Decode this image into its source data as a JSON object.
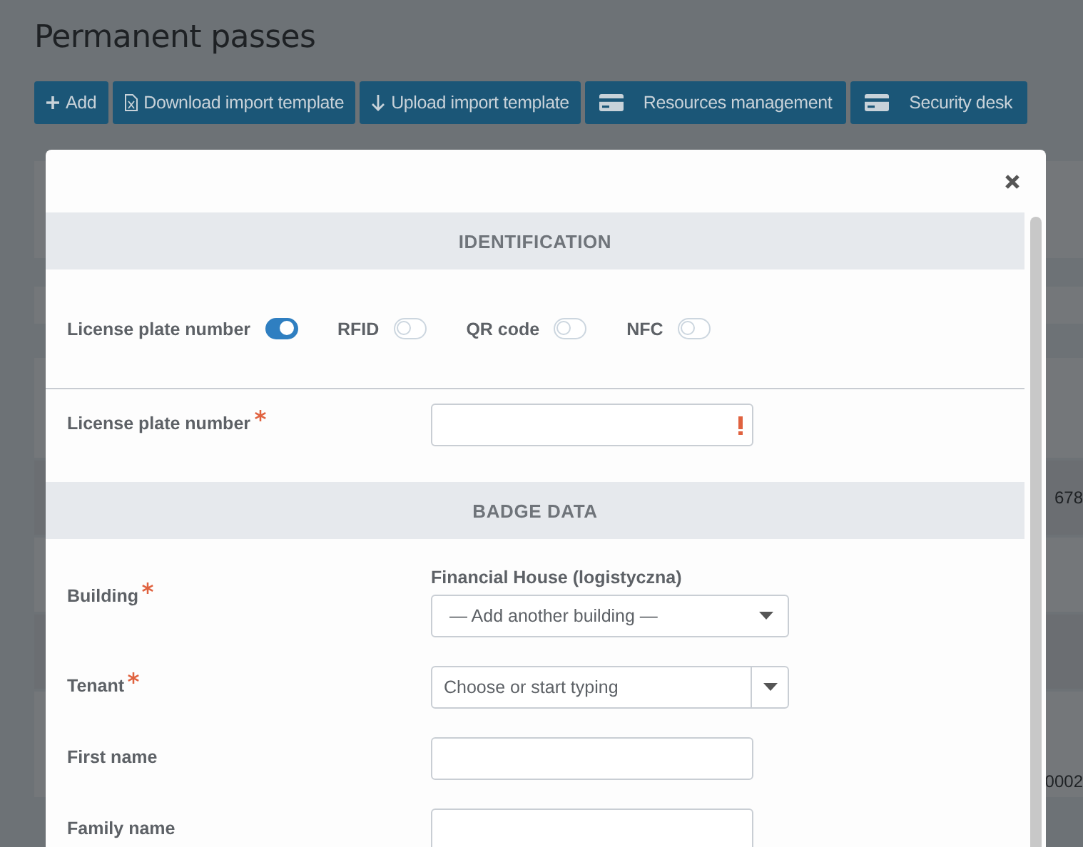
{
  "page": {
    "title": "Permanent passes"
  },
  "toolbar": [
    {
      "label": "Add",
      "kind": "add"
    },
    {
      "label": "Download import template",
      "kind": "download"
    },
    {
      "label": "Upload import template",
      "kind": "upload"
    },
    {
      "label": "Resources management",
      "kind": "resources"
    },
    {
      "label": "Security desk",
      "kind": "desk"
    }
  ],
  "background_rows": [
    {
      "cell": ""
    },
    {
      "cell": "678"
    },
    {
      "cell": ""
    },
    {
      "cell": ""
    },
    {
      "cell": "0002"
    }
  ],
  "modal": {
    "sections": [
      {
        "title": "IDENTIFICATION",
        "kind": "toggles",
        "toggles": [
          {
            "label": "License plate number",
            "on": true
          },
          {
            "label": "RFID",
            "on": false
          },
          {
            "label": "QR code",
            "on": false
          },
          {
            "label": "NFC",
            "on": false
          }
        ],
        "fields": [
          {
            "kind": "text",
            "label": "License plate number",
            "required": true,
            "invalid": true
          }
        ]
      },
      {
        "title": "BADGE DATA",
        "kind": "form",
        "fields": [
          {
            "kind": "select",
            "label": "Building",
            "required": true,
            "caption": "Financial House (logistyczna)",
            "placeholder": "— Add another building —"
          },
          {
            "kind": "combo",
            "label": "Tenant",
            "required": true,
            "placeholder": "Choose or start typing"
          },
          {
            "kind": "text",
            "label": "First name",
            "required": false,
            "invalid": false
          },
          {
            "kind": "text",
            "label": "Family name",
            "required": false,
            "invalid": false
          }
        ]
      }
    ]
  }
}
